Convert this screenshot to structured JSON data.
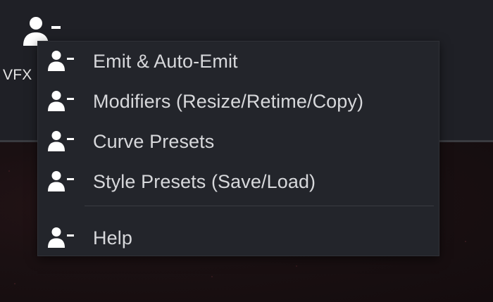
{
  "toolbar": {
    "vfx_button": {
      "label": "VFX",
      "icon": "user-minus-icon"
    }
  },
  "menu": {
    "items": [
      {
        "label": "Emit & Auto-Emit",
        "icon": "user-minus-icon"
      },
      {
        "label": "Modifiers (Resize/Retime/Copy)",
        "icon": "user-minus-icon"
      },
      {
        "label": "Curve Presets",
        "icon": "user-minus-icon"
      },
      {
        "label": "Style Presets (Save/Load)",
        "icon": "user-minus-icon"
      }
    ],
    "help_item": {
      "label": "Help",
      "icon": "user-minus-icon"
    }
  },
  "colors": {
    "toolbar_bg": "#1f2026",
    "menu_bg": "#23252b",
    "text": "#d7d8db",
    "icon": "#ffffff",
    "viewport_bg": "#140c0e"
  }
}
